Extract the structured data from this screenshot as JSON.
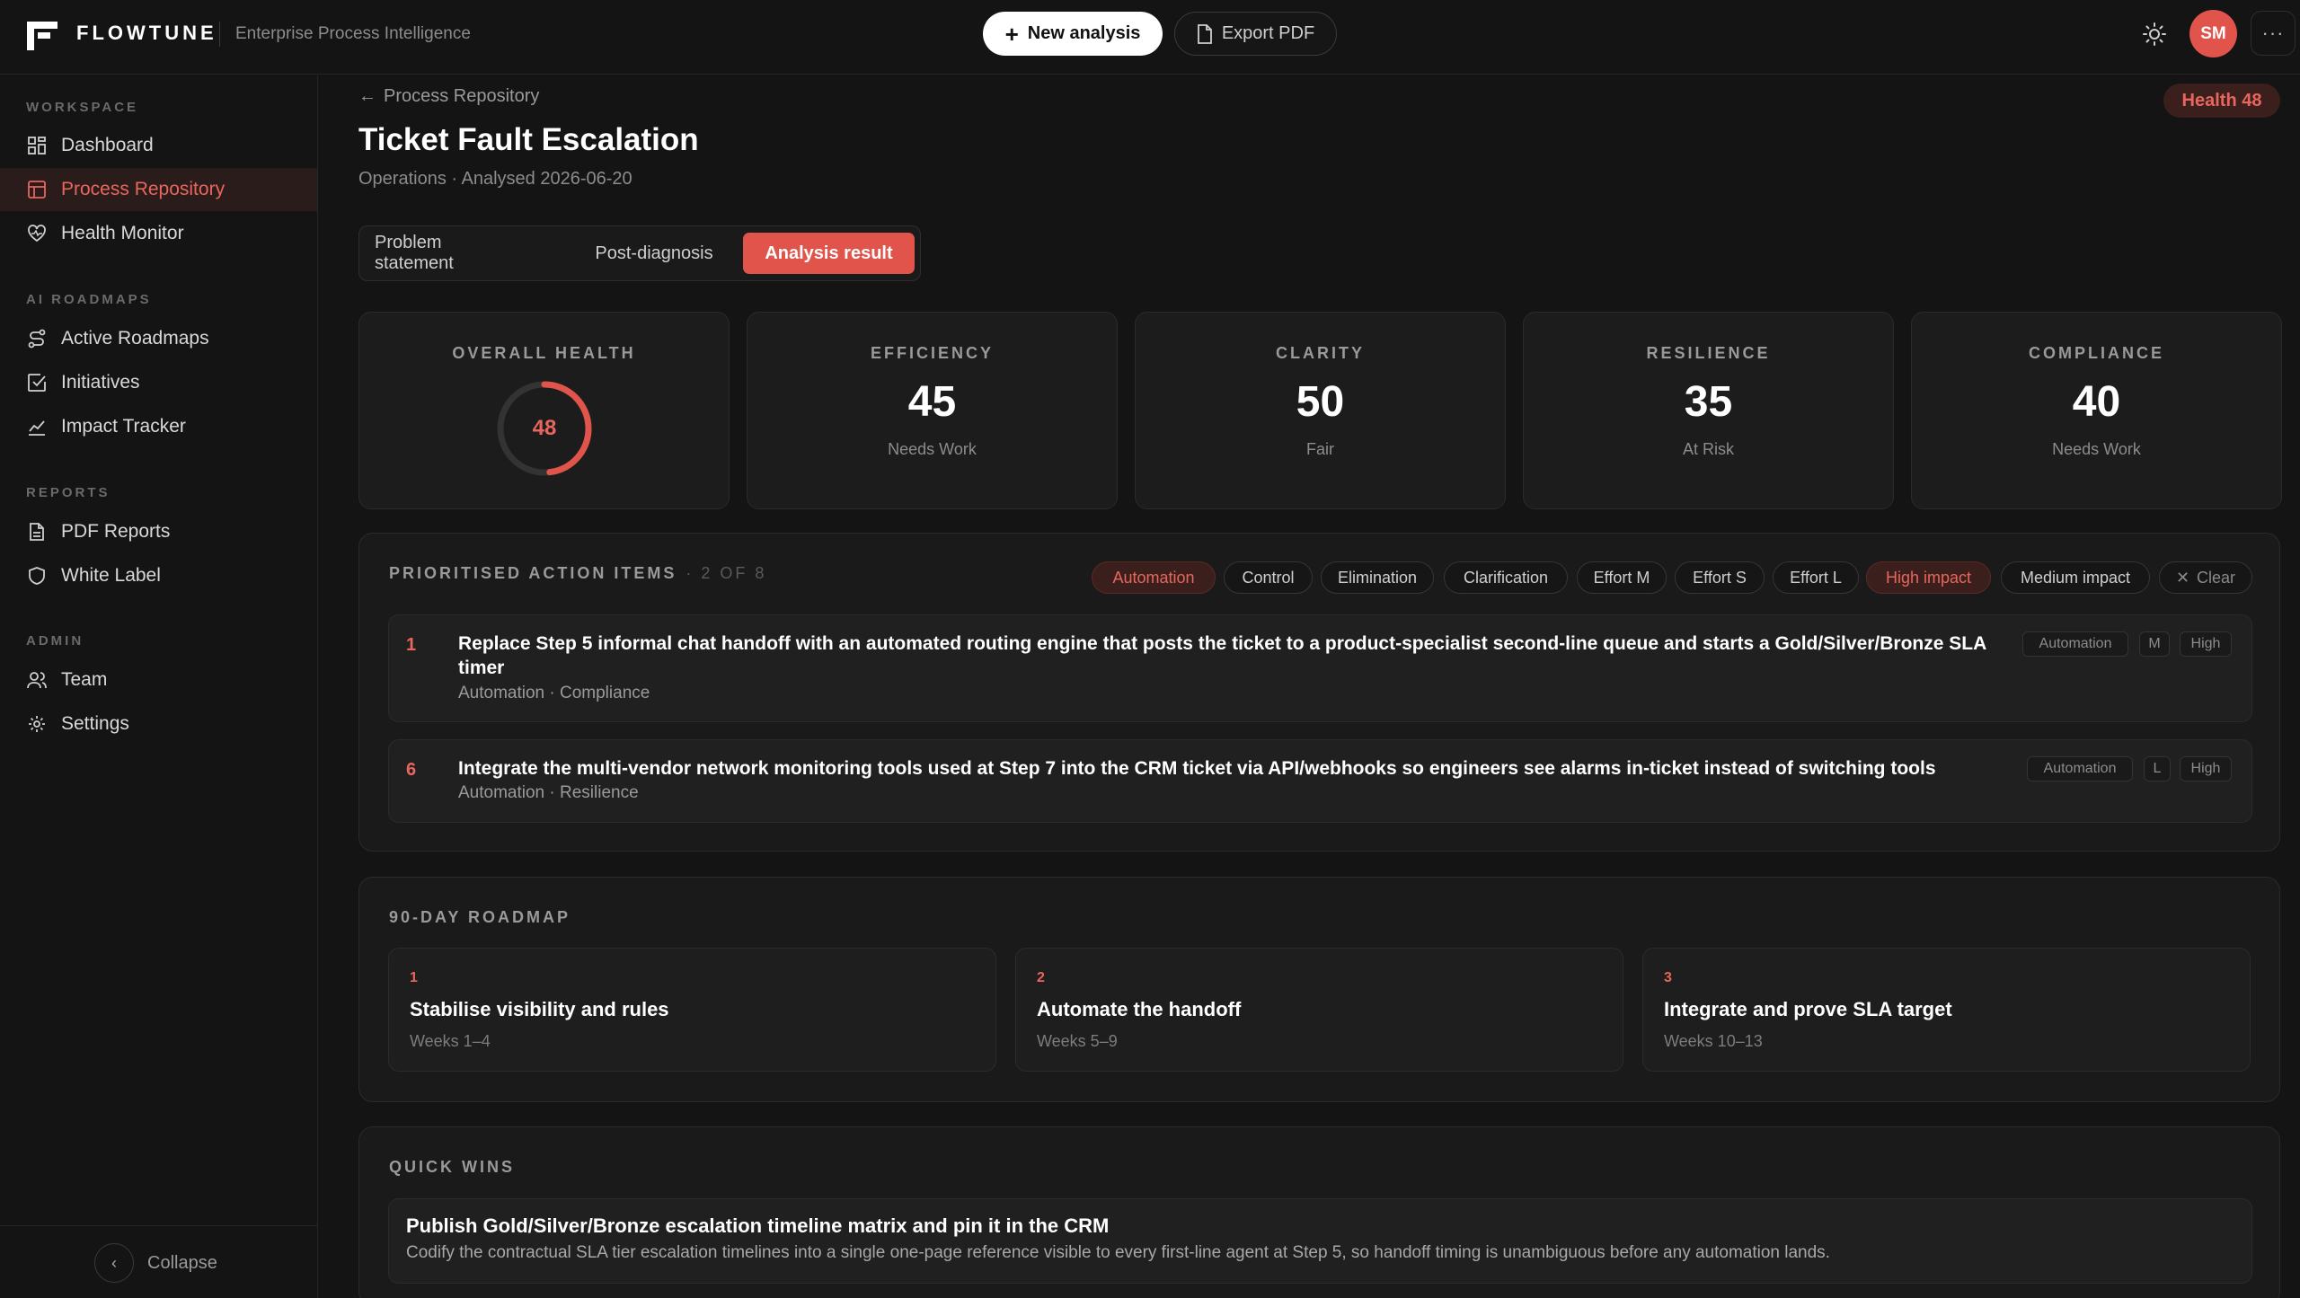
{
  "header": {
    "brand": "FLOWTUNE",
    "tagline": "Enterprise Process Intelligence",
    "new_analysis": "New analysis",
    "export_pdf": "Export PDF",
    "avatar_initials": "SM",
    "more": "···"
  },
  "sidebar": {
    "sections": {
      "workspace": "WORKSPACE",
      "ai_roadmaps": "AI ROADMAPS",
      "reports": "REPORTS",
      "admin": "ADMIN"
    },
    "items": [
      {
        "label": "Dashboard",
        "icon": "grid-icon"
      },
      {
        "label": "Process Repository",
        "icon": "table-icon",
        "active": true
      },
      {
        "label": "Health Monitor",
        "icon": "heart-pulse-icon"
      },
      {
        "label": "Active Roadmaps",
        "icon": "route-icon"
      },
      {
        "label": "Initiatives",
        "icon": "check-square-icon"
      },
      {
        "label": "Impact Tracker",
        "icon": "trend-icon"
      },
      {
        "label": "PDF Reports",
        "icon": "file-icon"
      },
      {
        "label": "White Label",
        "icon": "shield-icon"
      },
      {
        "label": "Team",
        "icon": "users-icon"
      },
      {
        "label": "Settings",
        "icon": "gear-icon"
      }
    ],
    "collapse": "Collapse"
  },
  "page": {
    "breadcrumb": "Process Repository",
    "health_badge": "Health 48",
    "title": "Ticket Fault Escalation",
    "subtitle": "Operations · Analysed 2026-06-20",
    "tabs": [
      "Problem statement",
      "Post-diagnosis",
      "Analysis result"
    ],
    "active_tab": "Analysis result"
  },
  "scores": {
    "overall": {
      "label": "OVERALL HEALTH",
      "value": "48",
      "fraction": 0.48
    },
    "cards": [
      {
        "label": "EFFICIENCY",
        "value": "45",
        "note": "Needs Work"
      },
      {
        "label": "CLARITY",
        "value": "50",
        "note": "Fair"
      },
      {
        "label": "RESILIENCE",
        "value": "35",
        "note": "At Risk"
      },
      {
        "label": "COMPLIANCE",
        "value": "40",
        "note": "Needs Work"
      }
    ]
  },
  "actions": {
    "heading": "PRIORITISED ACTION ITEMS",
    "count": "· 2 OF 8",
    "filters": [
      {
        "label": "Automation",
        "active": true
      },
      {
        "label": "Control",
        "active": false
      },
      {
        "label": "Elimination",
        "active": false
      },
      {
        "label": "Clarification",
        "active": false
      },
      {
        "label": "Effort M",
        "active": false
      },
      {
        "label": "Effort S",
        "active": false
      },
      {
        "label": "Effort L",
        "active": false
      },
      {
        "label": "High impact",
        "active": true
      },
      {
        "label": "Medium impact",
        "active": false
      }
    ],
    "clear": "Clear",
    "items": [
      {
        "num": "1",
        "title": "Replace Step 5 informal chat handoff with an automated routing engine that posts the ticket to a product-specialist second-line queue and starts a Gold/Silver/Bronze SLA timer",
        "meta": "Automation · Compliance",
        "tags": [
          "Automation",
          "M",
          "High"
        ]
      },
      {
        "num": "6",
        "title": "Integrate the multi-vendor network monitoring tools used at Step 7 into the CRM ticket via API/webhooks so engineers see alarms in-ticket instead of switching tools",
        "meta": "Automation · Resilience",
        "tags": [
          "Automation",
          "L",
          "High"
        ]
      }
    ]
  },
  "roadmap": {
    "heading": "90-DAY ROADMAP",
    "phases": [
      {
        "num": "1",
        "title": "Stabilise visibility and rules",
        "weeks": "Weeks 1–4"
      },
      {
        "num": "2",
        "title": "Automate the handoff",
        "weeks": "Weeks 5–9"
      },
      {
        "num": "3",
        "title": "Integrate and prove SLA target",
        "weeks": "Weeks 10–13"
      }
    ]
  },
  "quick_wins": {
    "heading": "QUICK WINS",
    "items": [
      {
        "title": "Publish Gold/Silver/Bronze escalation timeline matrix and pin it in the CRM",
        "desc": "Codify the contractual SLA tier escalation timelines into a single one-page reference visible to every first-line agent at Step 5, so handoff timing is unambiguous before any automation lands."
      }
    ]
  },
  "colors": {
    "accent": "#e0544b",
    "accent_text": "#e8665d",
    "background": "#141414"
  }
}
